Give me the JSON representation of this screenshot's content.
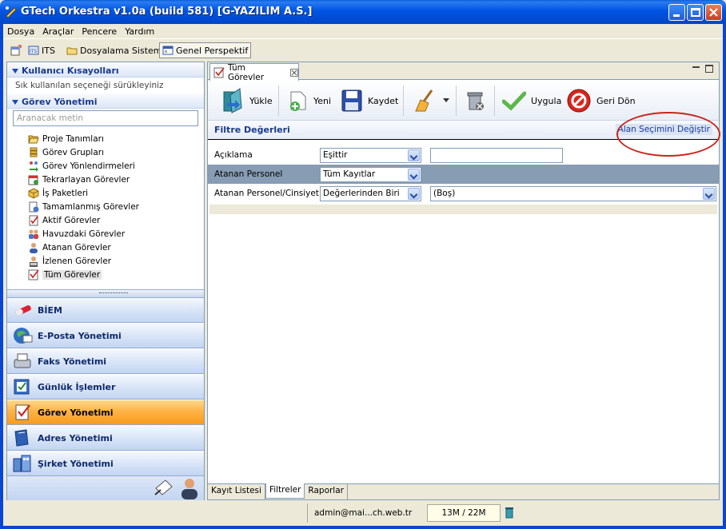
{
  "window": {
    "title": "GTech Orkestra v1.0a (build 581) [G-YAZILIM A.S.]",
    "title_color": "#0054E3"
  },
  "menu": [
    "Dosya",
    "Araçlar",
    "Pencere",
    "Yardım"
  ],
  "perspective_bar": {
    "items": [
      {
        "label": "",
        "icon": "perspective-icon"
      },
      {
        "label": "ITS",
        "icon": "its-icon"
      },
      {
        "label": "Dosyalama Sistemi",
        "icon": "folder-icon"
      },
      {
        "label": "Genel Perspektif",
        "icon": "window-icon",
        "selected": true
      }
    ]
  },
  "left": {
    "shortcuts_header": "Kullanıcı Kısayolları",
    "shortcuts_hint": "Sık kullanılan seçeneği sürükleyiniz",
    "task_header": "Görev Yönetimi",
    "search_placeholder": "Aranacak metin",
    "tree": [
      {
        "label": "Proje Tanımları",
        "icon": "folder-open-icon"
      },
      {
        "label": "Görev Grupları",
        "icon": "stack-icon"
      },
      {
        "label": "Görev Yönlendirmeleri",
        "icon": "redirect-icon"
      },
      {
        "label": "Tekrarlayan Görevler",
        "icon": "calendar-icon"
      },
      {
        "label": "İş Paketleri",
        "icon": "package-icon"
      },
      {
        "label": "Tamamlanmış Görevler",
        "icon": "done-icon"
      },
      {
        "label": "Aktif Görevler",
        "icon": "checklist-icon"
      },
      {
        "label": "Havuzdaki Görevler",
        "icon": "people-icon"
      },
      {
        "label": "Atanan Görevler",
        "icon": "user-icon"
      },
      {
        "label": "İzlenen Görevler",
        "icon": "watch-icon"
      },
      {
        "label": "Tüm Görevler",
        "icon": "all-tasks-icon",
        "selected": true
      }
    ],
    "nav": [
      {
        "label": "BİEM",
        "icon": "biem-icon"
      },
      {
        "label": "E-Posta Yönetimi",
        "icon": "email-icon"
      },
      {
        "label": "Faks Yönetimi",
        "icon": "fax-icon"
      },
      {
        "label": "Günlük İşlemler",
        "icon": "daily-icon"
      },
      {
        "label": "Görev Yönetimi",
        "icon": "task-icon",
        "active": true
      },
      {
        "label": "Adres Yönetimi",
        "icon": "address-icon"
      },
      {
        "label": "Şirket Yönetimi",
        "icon": "company-icon"
      }
    ]
  },
  "main": {
    "tab_label": "Tüm Görevler",
    "toolbar": {
      "load": "Yükle",
      "new": "Yeni",
      "save": "Kaydet",
      "apply": "Uygula",
      "back": "Geri Dön"
    },
    "filter_title": "Filtre Değerleri",
    "filter_link": "Alan Seçimini Değiştir",
    "filters": [
      {
        "label": "Açıklama",
        "operator": "Eşittir",
        "value": ""
      },
      {
        "label": "Atanan Personel",
        "operator": "Tüm Kayıtlar",
        "value": ""
      },
      {
        "label": "Atanan Personel/Cinsiyet",
        "operator": "Değerlerinden Biri",
        "value": "(Boş)"
      }
    ],
    "bottom_tabs": [
      "Kayıt Listesi",
      "Filtreler",
      "Raporlar"
    ],
    "selected_bottom_tab": "Filtreler"
  },
  "status": {
    "user": "admin@mai...ch.web.tr",
    "memory": "13M / 22M"
  }
}
